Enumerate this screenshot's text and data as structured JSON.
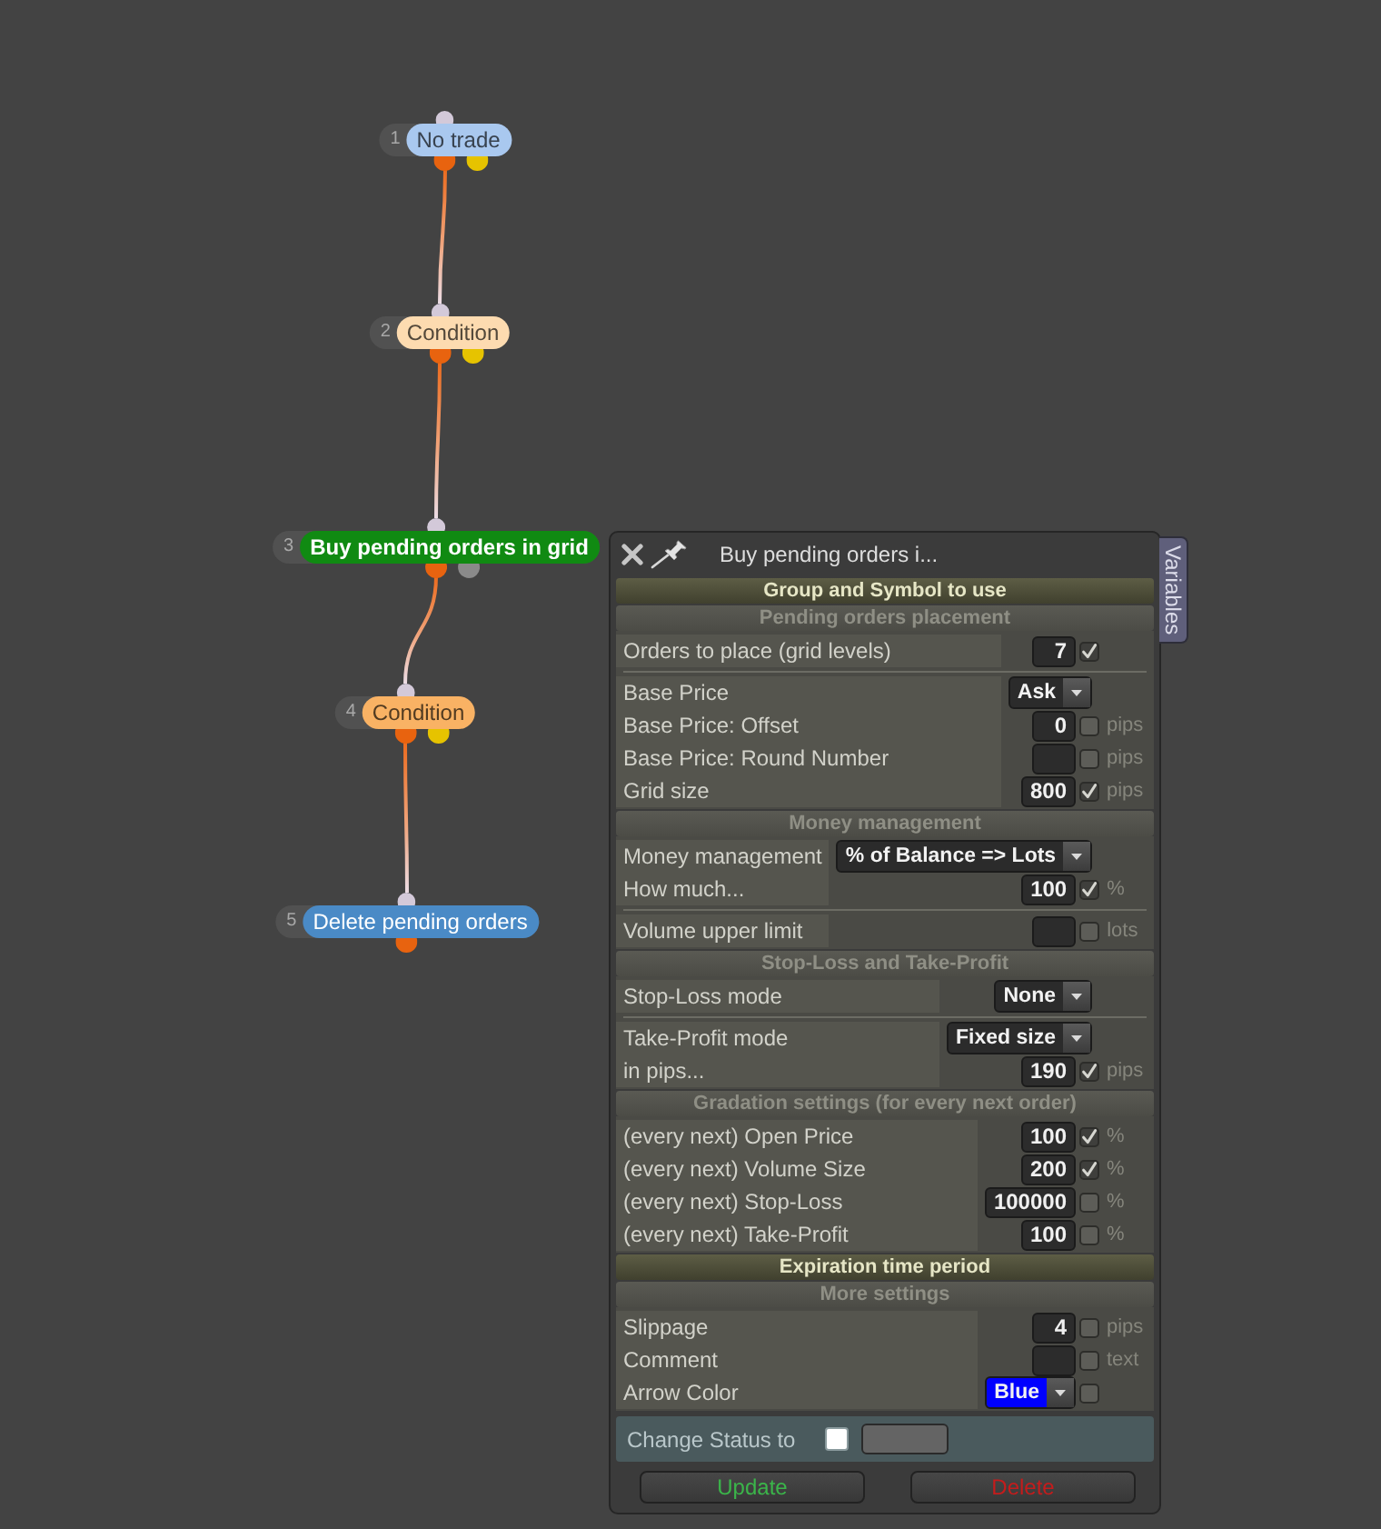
{
  "canvas": {
    "nodes": [
      {
        "number": "1",
        "label": "No trade",
        "color": "#a9c8ef",
        "bold": false,
        "outputs": [
          {
            "color": "#e8630f"
          },
          {
            "color": "#e6c300"
          }
        ],
        "children": [
          {
            "number": "2",
            "label": "Condition",
            "color": "#fddbb0",
            "bold": false,
            "outputs": [
              {
                "color": "#e8630f"
              },
              {
                "color": "#e6c300"
              }
            ],
            "children": [
              {
                "number": "3",
                "label": "Buy pending orders in grid",
                "color": "#108a12",
                "bold": true,
                "outputs": [
                  {
                    "color": "#e8630f"
                  },
                  {
                    "color": "#8a8a8a"
                  }
                ],
                "children": [
                  {
                    "number": "4",
                    "label": "Condition",
                    "color": "#f9b264",
                    "bold": false,
                    "outputs": [
                      {
                        "color": "#e8630f"
                      },
                      {
                        "color": "#e6c300"
                      }
                    ],
                    "children": [
                      {
                        "number": "5",
                        "label": "Delete pending orders",
                        "color": "#4a8ac6",
                        "bold": false,
                        "outputs": [
                          {
                            "color": "#e8630f"
                          }
                        ]
                      }
                    ]
                  }
                ]
              }
            ]
          }
        ]
      }
    ]
  },
  "panel": {
    "title": "Buy pending orders i...",
    "side_tab": "Variables",
    "sections": [
      {
        "title": "Group and Symbol to use",
        "expanded": false
      },
      {
        "title": "Pending orders placement",
        "expanded": true,
        "blocks": [
          {
            "rows": [
              {
                "kind": "input",
                "label": "Orders to place (grid levels)",
                "value": "7",
                "checked": true
              }
            ]
          },
          {
            "rows": [
              {
                "kind": "dropdown",
                "label": "Base Price",
                "value": "Ask"
              },
              {
                "kind": "input",
                "label": "Base Price: Offset",
                "value": "0",
                "checked": false,
                "unit": "pips"
              },
              {
                "kind": "input",
                "label": "Base Price: Round Number",
                "checked": false,
                "unit": "pips"
              },
              {
                "kind": "input",
                "label": "Grid size",
                "value": "800",
                "checked": true,
                "unit": "pips"
              }
            ]
          }
        ]
      },
      {
        "title": "Money management",
        "expanded": true,
        "blocks": [
          {
            "rows": [
              {
                "kind": "dropdown",
                "label": "Money management",
                "value": "% of Balance => Lots"
              },
              {
                "kind": "input",
                "label": "How much...",
                "value": "100",
                "checked": true,
                "unit": "%"
              }
            ]
          },
          {
            "rows": [
              {
                "kind": "input",
                "label": "Volume upper limit",
                "checked": false,
                "unit": "lots"
              }
            ]
          }
        ]
      },
      {
        "title": "Stop-Loss and Take-Profit",
        "expanded": true,
        "blocks": [
          {
            "rows": [
              {
                "kind": "dropdown",
                "label": "Stop-Loss mode",
                "value": "None"
              }
            ]
          },
          {
            "rows": [
              {
                "kind": "dropdown",
                "label": "Take-Profit mode",
                "value": "Fixed size"
              },
              {
                "kind": "input",
                "label": "in pips...",
                "value": "190",
                "checked": true,
                "unit": "pips"
              }
            ]
          }
        ]
      },
      {
        "title": "Gradation settings (for every next order)",
        "expanded": true,
        "blocks": [
          {
            "rows": [
              {
                "kind": "input",
                "label": "(every next) Open Price",
                "value": "100",
                "checked": true,
                "unit": "%"
              },
              {
                "kind": "input",
                "label": "(every next) Volume Size",
                "value": "200",
                "checked": true,
                "unit": "%"
              },
              {
                "kind": "input",
                "label": "(every next) Stop-Loss",
                "value": "100000",
                "checked": false,
                "unit": "%"
              },
              {
                "kind": "input",
                "label": "(every next) Take-Profit",
                "value": "100",
                "checked": false,
                "unit": "%"
              }
            ]
          }
        ]
      },
      {
        "title": "Expiration time period",
        "expanded": false
      },
      {
        "title": "More settings",
        "expanded": true,
        "blocks": [
          {
            "rows": [
              {
                "kind": "input",
                "label": "Slippage",
                "value": "4",
                "checked": false,
                "unit": "pips"
              },
              {
                "kind": "input",
                "label": "Comment",
                "checked": false,
                "unit": "text"
              },
              {
                "kind": "dropdown",
                "label": "Arrow Color",
                "value": "Blue",
                "color": "#0000ff",
                "checked": false
              }
            ]
          }
        ]
      }
    ],
    "status_change": {
      "label": "Change Status to",
      "checked": false
    },
    "buttons": [
      {
        "kind": "update",
        "label": "Update"
      },
      {
        "kind": "delete",
        "label": "Delete"
      }
    ]
  }
}
